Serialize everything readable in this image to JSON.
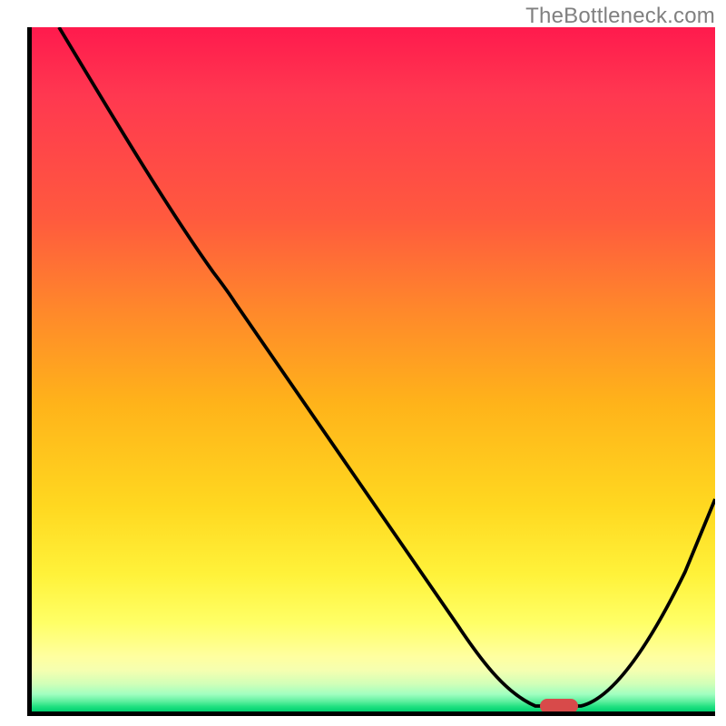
{
  "watermark": "TheBottleneck.com",
  "chart_data": {
    "type": "line",
    "title": "",
    "xlabel": "",
    "ylabel": "",
    "xlim": [
      0,
      100
    ],
    "ylim": [
      0,
      100
    ],
    "x": [
      0,
      10,
      20,
      30,
      40,
      50,
      60,
      65,
      70,
      75,
      80,
      85,
      90,
      95,
      100
    ],
    "values": [
      100,
      88,
      76,
      64,
      51,
      38,
      24,
      15,
      5,
      1,
      0,
      2,
      10,
      25,
      40
    ],
    "background_gradient": {
      "type": "vertical",
      "stops": [
        {
          "pos": 0.0,
          "color": "#ff1a4d"
        },
        {
          "pos": 0.3,
          "color": "#ff6a30"
        },
        {
          "pos": 0.55,
          "color": "#ffb31a"
        },
        {
          "pos": 0.8,
          "color": "#fff23a"
        },
        {
          "pos": 0.92,
          "color": "#ffff90"
        },
        {
          "pos": 0.97,
          "color": "#b0ffb8"
        },
        {
          "pos": 1.0,
          "color": "#00d070"
        }
      ]
    },
    "marker": {
      "shape": "rounded-rect",
      "approx_x": 78,
      "approx_y": 0,
      "color": "#d84a4a"
    }
  }
}
